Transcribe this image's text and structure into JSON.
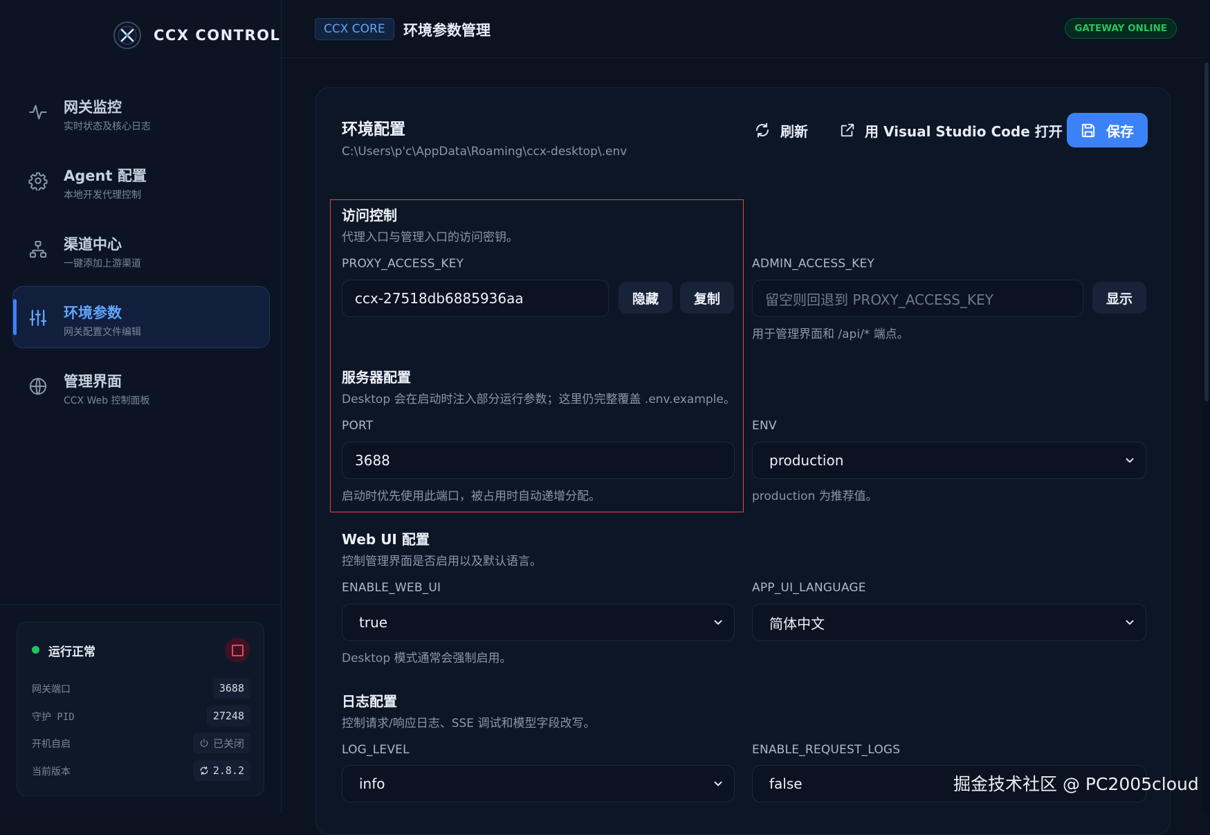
{
  "brand": {
    "name": "CCX CONTROL"
  },
  "nav": {
    "items": [
      {
        "title": "网关监控",
        "subtitle": "实时状态及核心日志",
        "icon": "activity-icon"
      },
      {
        "title": "Agent 配置",
        "subtitle": "本地开发代理控制",
        "icon": "gear-icon"
      },
      {
        "title": "渠道中心",
        "subtitle": "一键添加上游渠道",
        "icon": "network-icon"
      },
      {
        "title": "环境参数",
        "subtitle": "网关配置文件编辑",
        "icon": "sliders-icon",
        "active": true
      },
      {
        "title": "管理界面",
        "subtitle": "CCX Web 控制面板",
        "icon": "globe-icon"
      }
    ]
  },
  "status": {
    "text": "运行正常",
    "rows": [
      {
        "label": "网关端口",
        "value": "3688"
      },
      {
        "label": "守护 PID",
        "value": "27248"
      },
      {
        "label": "开机自启",
        "value": "已关闭",
        "icon": "power-icon"
      },
      {
        "label": "当前版本",
        "value": "2.8.2",
        "icon": "refresh-icon"
      }
    ]
  },
  "header": {
    "tag": "CCX CORE",
    "title": "环境参数管理",
    "badge": "GATEWAY ONLINE"
  },
  "panel": {
    "title": "环境配置",
    "path": "C:\\Users\\p'c\\AppData\\Roaming\\ccx-desktop\\.env",
    "refresh_label": "刷新",
    "open_label": "用 Visual Studio Code 打开",
    "save_label": "保存"
  },
  "access": {
    "title": "访问控制",
    "desc": "代理入口与管理入口的访问密钥。",
    "proxy": {
      "label": "PROXY_ACCESS_KEY",
      "value": "ccx-27518db6885936aa",
      "hide_label": "隐藏",
      "copy_label": "复制"
    },
    "admin": {
      "label": "ADMIN_ACCESS_KEY",
      "placeholder": "留空则回退到 PROXY_ACCESS_KEY",
      "show_label": "显示",
      "hint": "用于管理界面和 /api/* 端点。"
    }
  },
  "server": {
    "title": "服务器配置",
    "desc": "Desktop 会在启动时注入部分运行参数；这里仍完整覆盖 .env.example。",
    "port": {
      "label": "PORT",
      "value": "3688",
      "hint": "启动时优先使用此端口，被占用时自动递增分配。"
    },
    "env": {
      "label": "ENV",
      "value": "production",
      "hint": "production 为推荐值。"
    }
  },
  "webui": {
    "title": "Web UI 配置",
    "desc": "控制管理界面是否启用以及默认语言。",
    "enable": {
      "label": "ENABLE_WEB_UI",
      "value": "true",
      "hint": "Desktop 模式通常会强制启用。"
    },
    "language": {
      "label": "APP_UI_LANGUAGE",
      "value": "简体中文"
    }
  },
  "logs": {
    "title": "日志配置",
    "desc": "控制请求/响应日志、SSE 调试和模型字段改写。",
    "level": {
      "label": "LOG_LEVEL",
      "value": "info"
    },
    "request": {
      "label": "ENABLE_REQUEST_LOGS",
      "value": "false"
    }
  },
  "watermark": "掘金技术社区 @ PC2005cloud",
  "colors": {
    "accent": "#3b82f6",
    "online": "#22c55e",
    "danger": "#ef4444",
    "background": "#0b1220"
  }
}
